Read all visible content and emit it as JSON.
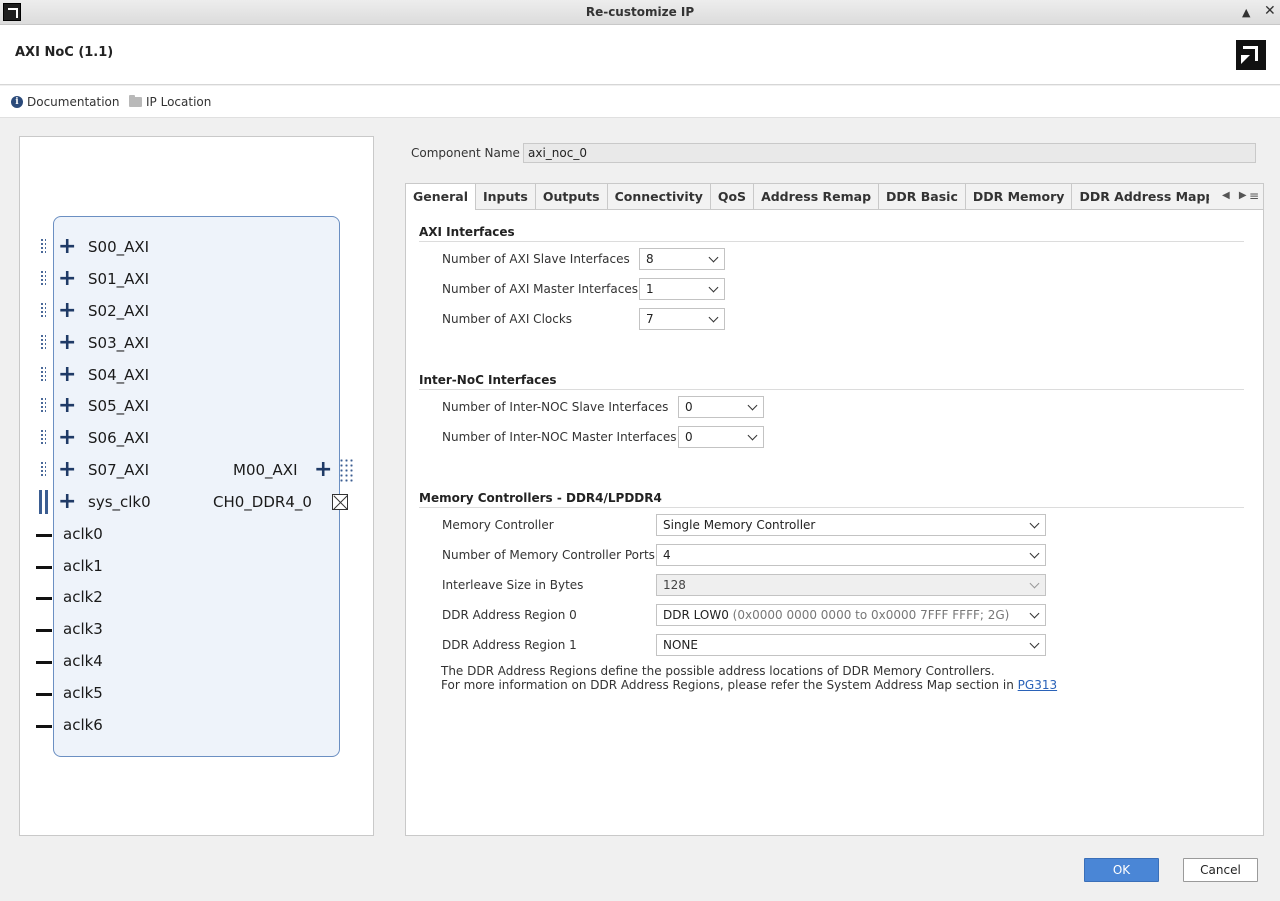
{
  "window": {
    "title": "Re-customize IP",
    "minimize_label": "▲",
    "close_label": "✕"
  },
  "header": {
    "ip_title": "AXI NoC (1.1)"
  },
  "docbar": {
    "documentation": "Documentation",
    "ip_location": "IP Location"
  },
  "symbol": {
    "slave_pins": [
      "S00_AXI",
      "S01_AXI",
      "S02_AXI",
      "S03_AXI",
      "S04_AXI",
      "S05_AXI",
      "S06_AXI",
      "S07_AXI",
      "sys_clk0"
    ],
    "clock_pins": [
      "aclk0",
      "aclk1",
      "aclk2",
      "aclk3",
      "aclk4",
      "aclk5",
      "aclk6"
    ],
    "master_pin": "M00_AXI",
    "ddr_pin": "CH0_DDR4_0"
  },
  "component": {
    "label": "Component Name",
    "value": "axi_noc_0"
  },
  "tabs": [
    "General",
    "Inputs",
    "Outputs",
    "Connectivity",
    "QoS",
    "Address Remap",
    "DDR Basic",
    "DDR Memory",
    "DDR Address Mapp"
  ],
  "tab_arrows": "◀ ▶",
  "tab_menu": "≡",
  "axi": {
    "title": "AXI Interfaces",
    "slave_label": "Number of AXI Slave Interfaces",
    "slave_value": "8",
    "master_label": "Number of AXI Master Interfaces",
    "master_value": "1",
    "clocks_label": "Number of AXI Clocks",
    "clocks_value": "7"
  },
  "inoc": {
    "title": "Inter-NoC Interfaces",
    "slave_label": "Number of Inter-NOC Slave Interfaces",
    "slave_value": "0",
    "master_label": "Number of Inter-NOC Master Interfaces",
    "master_value": "0"
  },
  "mc": {
    "title": "Memory Controllers - DDR4/LPDDR4",
    "controller_label": "Memory Controller",
    "controller_value": "Single Memory Controller",
    "ports_label": "Number of Memory Controller Ports",
    "ports_value": "4",
    "interleave_label": "Interleave Size in Bytes",
    "interleave_value": "128",
    "region0_label": "DDR Address Region 0",
    "region0_value": "DDR LOW0",
    "region0_detail": "(0x0000 0000 0000 to 0x0000 7FFF FFFF; 2G)",
    "region1_label": "DDR Address Region 1",
    "region1_value": "NONE",
    "help_line1": "The DDR Address Regions define the possible address locations of DDR Memory Controllers.",
    "help_line2": "For more information on DDR Address Regions, please refer the System Address Map section in",
    "help_link": "PG313"
  },
  "buttons": {
    "ok": "OK",
    "cancel": "Cancel"
  },
  "colors": {
    "accent": "#4a86d6",
    "block_fill": "#eef3fa",
    "block_border": "#6b8fc2",
    "pin_icon": "#1f3a66"
  }
}
